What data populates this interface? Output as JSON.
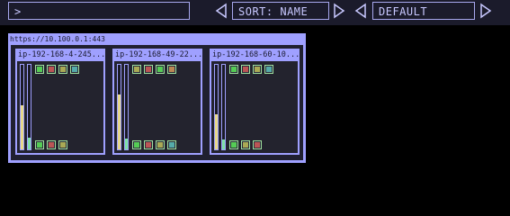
{
  "toolbar": {
    "prompt_value": ">",
    "sort_label": "SORT: NAME",
    "filter_label": "DEFAULT"
  },
  "cluster": {
    "url": "https://10.100.0.1:443",
    "nodes": [
      {
        "name": "ip-192-168-4-245...",
        "gauges": [
          {
            "color": "#e8d98c",
            "level": 0.52
          },
          {
            "color": "#7fe0a8",
            "level": 0.14
          }
        ],
        "pods_top": [
          "#55cc55",
          "#bb5555",
          "#aaaa55",
          "#55aaaa"
        ],
        "pods_bottom": [
          "#55cc55",
          "#bb5555",
          "#aaaa55"
        ]
      },
      {
        "name": "ip-192-168-49-22...",
        "gauges": [
          {
            "color": "#e8d98c",
            "level": 0.65
          },
          {
            "color": "#7fe0a8",
            "level": 0.13
          }
        ],
        "pods_top": [
          "#aaaa55",
          "#bb5555",
          "#55cc55",
          "#bb8855"
        ],
        "pods_bottom": [
          "#55cc55",
          "#bb5555",
          "#aaaa55",
          "#55aaaa"
        ]
      },
      {
        "name": "ip-192-168-60-10...",
        "gauges": [
          {
            "color": "#e8d98c",
            "level": 0.42
          },
          {
            "color": "#7fe0a8",
            "level": 0.12
          }
        ],
        "pods_top": [
          "#55cc55",
          "#bb5555",
          "#aaaa55",
          "#55aaaa"
        ],
        "pods_bottom": [
          "#55cc55",
          "#aaaa55",
          "#bb5555"
        ]
      }
    ]
  }
}
